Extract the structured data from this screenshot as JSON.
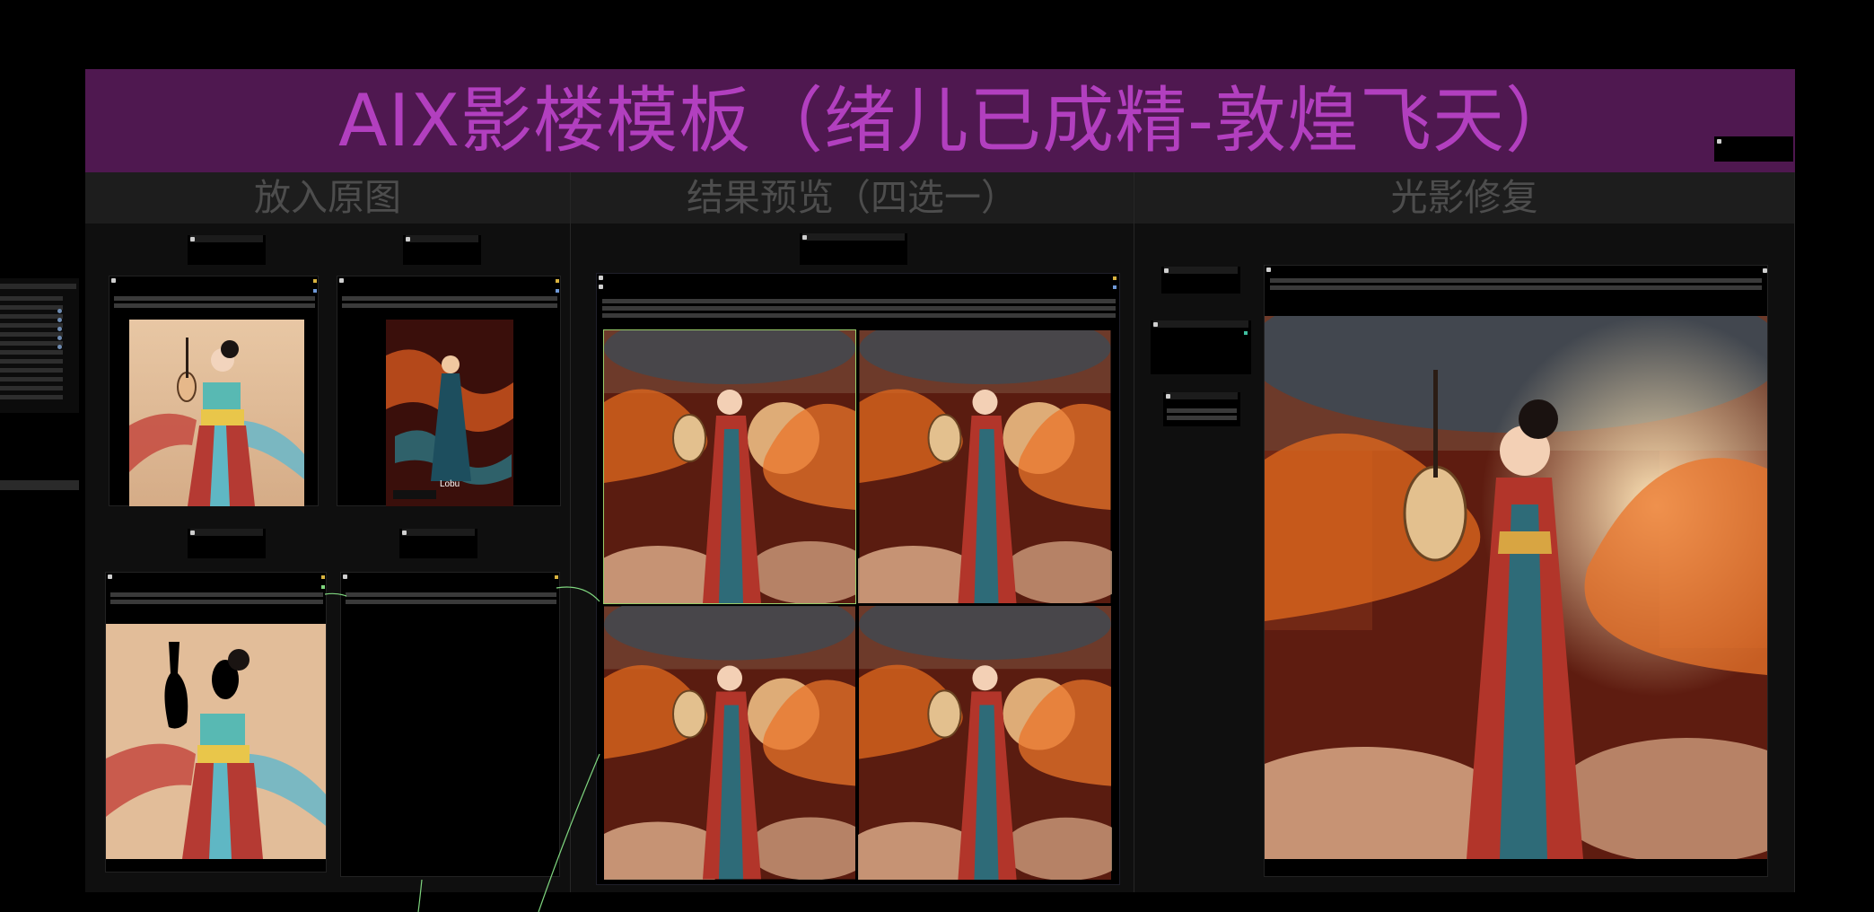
{
  "banner": {
    "title": "AIX影楼模板（绪儿已成精-敦煌飞天）"
  },
  "groups": [
    {
      "title": "放入原图"
    },
    {
      "title": "结果预览（四选一）"
    },
    {
      "title": "光影修复"
    }
  ],
  "colors": {
    "banner_bg": "#4f1850",
    "banner_text": "#b23fbf",
    "group_head_bg": "#1d1d1d",
    "group_head_text": "#4d4d4d",
    "link_green": "#7fd67f"
  },
  "poster": {
    "brand": "Lobu"
  }
}
